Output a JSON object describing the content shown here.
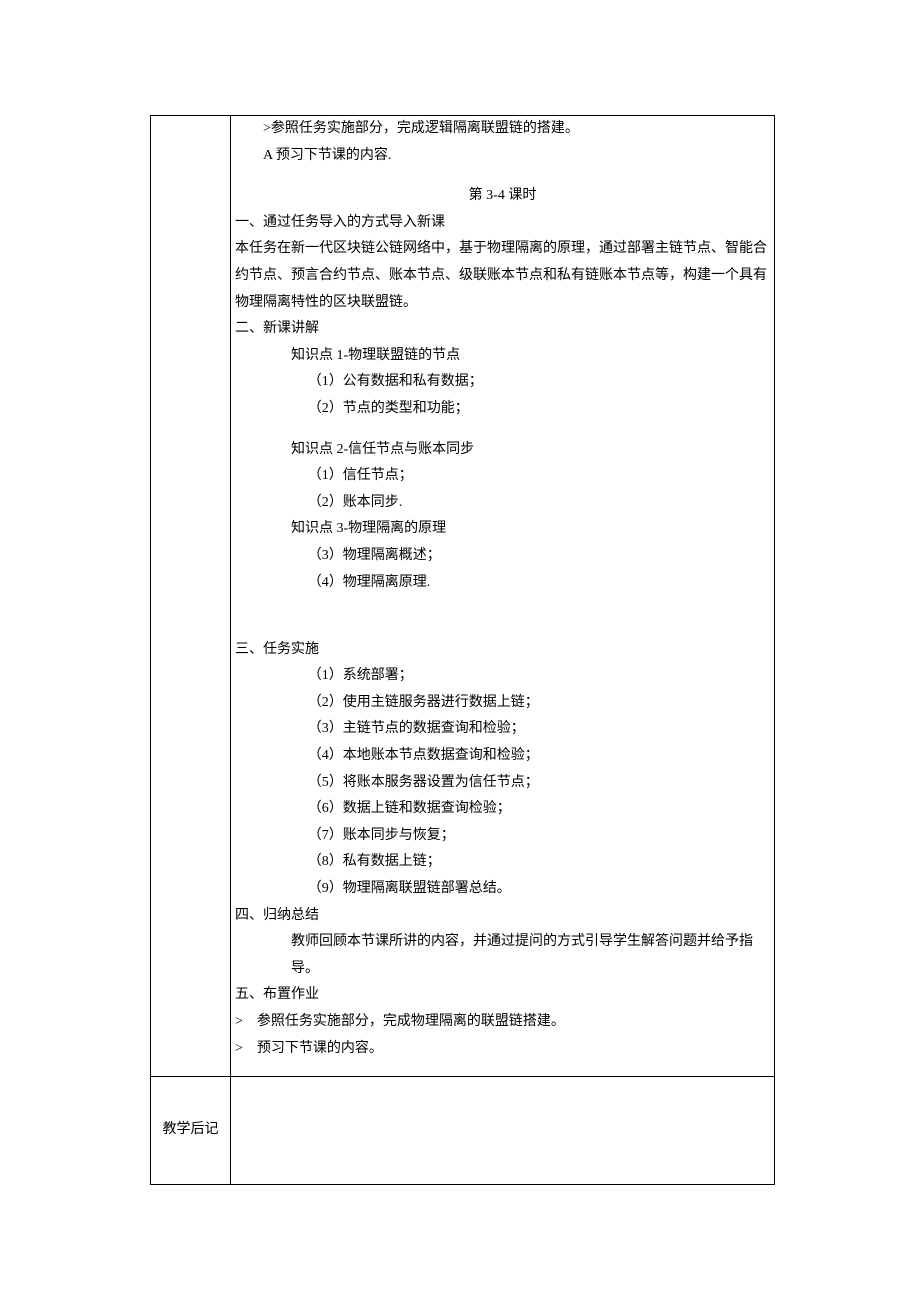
{
  "row1": {
    "lines": [
      {
        "cls": "i1",
        "text": ">参照任务实施部分，完成逻辑隔离联盟链的搭建。"
      },
      {
        "cls": "i1",
        "text": "A 预习下节课的内容."
      },
      {
        "cls": "gap-small",
        "text": ""
      },
      {
        "cls": "center",
        "text": "第 3-4 课时"
      },
      {
        "cls": "",
        "text": "一、通过任务导入的方式导入新课"
      },
      {
        "cls": "",
        "text": "本任务在新一代区块链公链网络中，基于物理隔离的原理，通过部署主链节点、智能合约节点、预言合约节点、账本节点、级联账本节点和私有链账本节点等，构建一个具有物理隔离特性的区块联盟链。"
      },
      {
        "cls": "",
        "text": "二、新课讲解"
      },
      {
        "cls": "i2",
        "text": "知识点 1-物理联盟链的节点"
      },
      {
        "cls": "i3",
        "text": "（1）公有数据和私有数据；"
      },
      {
        "cls": "i3",
        "text": "（2）节点的类型和功能；"
      },
      {
        "cls": "gap-small",
        "text": ""
      },
      {
        "cls": "i2",
        "text": "知识点 2-信任节点与账本同步"
      },
      {
        "cls": "i3",
        "text": "（1）信任节点；"
      },
      {
        "cls": "i3",
        "text": "（2）账本同步."
      },
      {
        "cls": "i2",
        "text": "知识点 3-物理隔离的原理"
      },
      {
        "cls": "i3",
        "text": "（3）物理隔离概述；"
      },
      {
        "cls": "i3",
        "text": "（4）物理隔离原理."
      },
      {
        "cls": "gap",
        "text": ""
      },
      {
        "cls": "gap-small",
        "text": ""
      },
      {
        "cls": "",
        "text": "三、任务实施"
      },
      {
        "cls": "i3",
        "text": "（1）系统部署；"
      },
      {
        "cls": "i3",
        "text": "（2）使用主链服务器进行数据上链；"
      },
      {
        "cls": "i3",
        "text": "（3）主链节点的数据查询和检验；"
      },
      {
        "cls": "i3",
        "text": "（4）本地账本节点数据查询和检验；"
      },
      {
        "cls": "i3",
        "text": "（5）将账本服务器设置为信任节点；"
      },
      {
        "cls": "i3",
        "text": "（6）数据上链和数据查询检验；"
      },
      {
        "cls": "i3",
        "text": "（7）账本同步与恢复；"
      },
      {
        "cls": "i3",
        "text": "（8）私有数据上链；"
      },
      {
        "cls": "i3",
        "text": "（9）物理隔离联盟链部署总结。"
      },
      {
        "cls": "",
        "text": "四、归纳总结"
      },
      {
        "cls": "i2",
        "text": "教师回顾本节课所讲的内容，并通过提问的方式引导学生解答问题并给予指导。"
      },
      {
        "cls": "",
        "text": "五、布置作业"
      },
      {
        "cls": "",
        "text": ">　参照任务实施部分，完成物理隔离的联盟链搭建。"
      },
      {
        "cls": "",
        "text": ">　预习下节课的内容。"
      }
    ]
  },
  "row2": {
    "label": "教学后记",
    "content": ""
  }
}
